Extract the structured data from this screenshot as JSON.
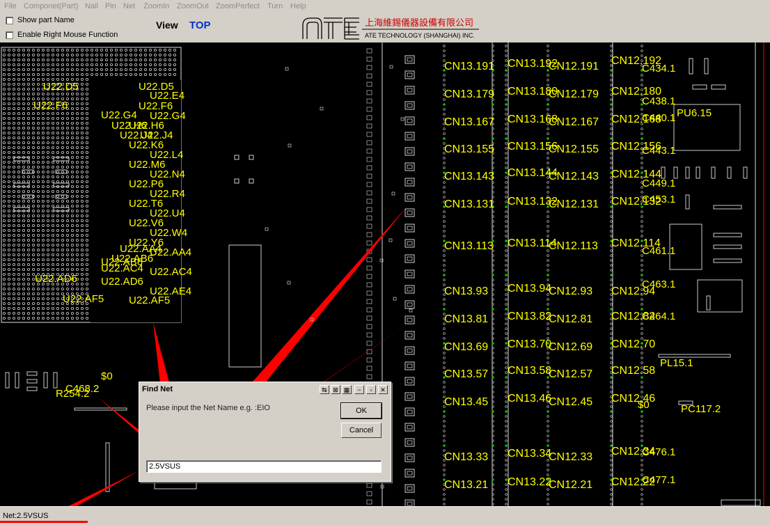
{
  "menu": [
    "File",
    "Componet(Part)",
    "Nail",
    "Pin",
    "Net",
    "ZoomIn",
    "ZoomOut",
    "ZoomPerfect",
    "Turn",
    "Help"
  ],
  "toolbar": {
    "show_part_name": "Show part Name",
    "enable_right_mouse": "Enable Right Mouse Function",
    "view_label": "View",
    "view_value": "TOP"
  },
  "logo": {
    "mark": "ATE",
    "chinese_name": "上海維錫儀器設備有限公司",
    "english_name": "ATE TECHNOLOGY (SHANGHAI) INC."
  },
  "board": {
    "bga_pins": [
      "U22.D5",
      "U22.E4",
      "U22.F6",
      "U22.G4",
      "U22.H6",
      "U22.J4",
      "U22.K6",
      "U22.L4",
      "U22.M6",
      "U22.N4",
      "U22.P6",
      "U22.R4",
      "U22.T6",
      "U22.U4",
      "U22.V6",
      "U22.W4",
      "U22.Y6",
      "U22.AA4",
      "U22.AB6",
      "U22.AC4",
      "U22.AD6",
      "U22.AE4",
      "U22.AF5"
    ],
    "connector_col1": [
      "CN13.191",
      "CN13.179",
      "CN13.167",
      "CN13.155",
      "CN13.143",
      "CN13.131",
      "CN13.113",
      "CN13.93",
      "CN13.81",
      "CN13.69",
      "CN13.57",
      "CN13.45",
      "CN13.33",
      "CN13.21"
    ],
    "connector_col2": [
      "CN13.192",
      "CN13.180",
      "CN13.168",
      "CN13.156",
      "CN13.144",
      "CN13.132",
      "CN13.114",
      "CN13.94",
      "CN13.82",
      "CN13.70",
      "CN13.58",
      "CN13.46",
      "CN13.34",
      "CN13.22"
    ],
    "connector_col3": [
      "CN12.191",
      "CN12.179",
      "CN12.167",
      "CN12.155",
      "CN12.143",
      "CN12.131",
      "CN12.113",
      "CN12.93",
      "CN12.81",
      "CN12.69",
      "CN12.57",
      "CN12.45",
      "CN12.33",
      "CN12.21"
    ],
    "connector_col4": [
      "CN12.192",
      "CN12.180",
      "CN12.168",
      "CN12.156",
      "CN12.144",
      "CN12.132",
      "CN12.114",
      "CN12.94",
      "CN12.82",
      "CN12.70",
      "CN12.58",
      "CN12.46",
      "CN12.34",
      "CN12.22"
    ],
    "right_parts": [
      "C434.1",
      "C438.1",
      "C440.1",
      "PU6.15",
      "C443.1",
      "C449.1",
      "C453.1",
      "C461.1",
      "C463.1",
      "C464.1",
      "PL15.1",
      "PC117.2",
      "C476.1",
      "C477.1",
      "$0"
    ],
    "left_parts": [
      "$0",
      "C468.2",
      "R254.2"
    ]
  },
  "dialog": {
    "title": "Find Net",
    "prompt": "Please input the Net Name e.g. :EIO",
    "ok": "OK",
    "cancel": "Cancel",
    "input_value": "2.5VSUS"
  },
  "status": {
    "text": "Net:2.5VSUS"
  },
  "colors": {
    "board_bg": "#000000",
    "label": "#ffff00",
    "annotation": "#ff0000",
    "view_value": "#0033cc"
  }
}
